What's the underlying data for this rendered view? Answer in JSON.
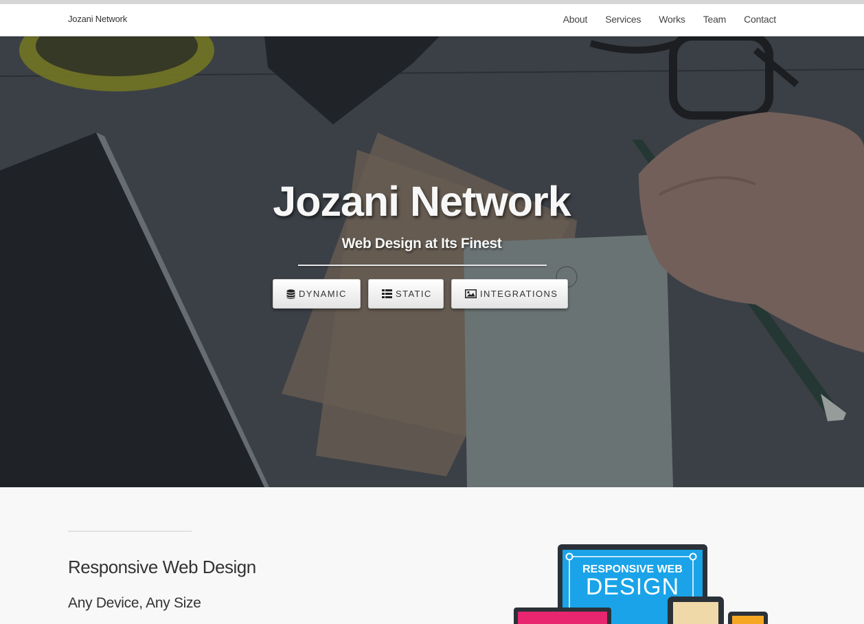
{
  "navbar": {
    "brand": "Jozani Network",
    "links": [
      "About",
      "Services",
      "Works",
      "Team",
      "Contact"
    ]
  },
  "hero": {
    "title": "Jozani Network",
    "subtitle": "Web Design at Its Finest",
    "buttons": [
      {
        "label": "DYNAMIC",
        "icon": "database-icon"
      },
      {
        "label": "STATIC",
        "icon": "list-icon"
      },
      {
        "label": "INTEGRATIONS",
        "icon": "image-icon"
      }
    ]
  },
  "section": {
    "heading": "Responsive Web Design",
    "subheading": "Any Device, Any Size",
    "illustration": {
      "line1": "RESPONSIVE WEB",
      "line2": "DESIGN"
    }
  },
  "colors": {
    "navbar_bg": "#ffffff",
    "hero_overlay": "#3c4147",
    "page_bg": "#f8f8f8",
    "illustration_blue": "#1aa3e8",
    "illustration_pink": "#e8266f",
    "illustration_orange": "#f5a623"
  }
}
